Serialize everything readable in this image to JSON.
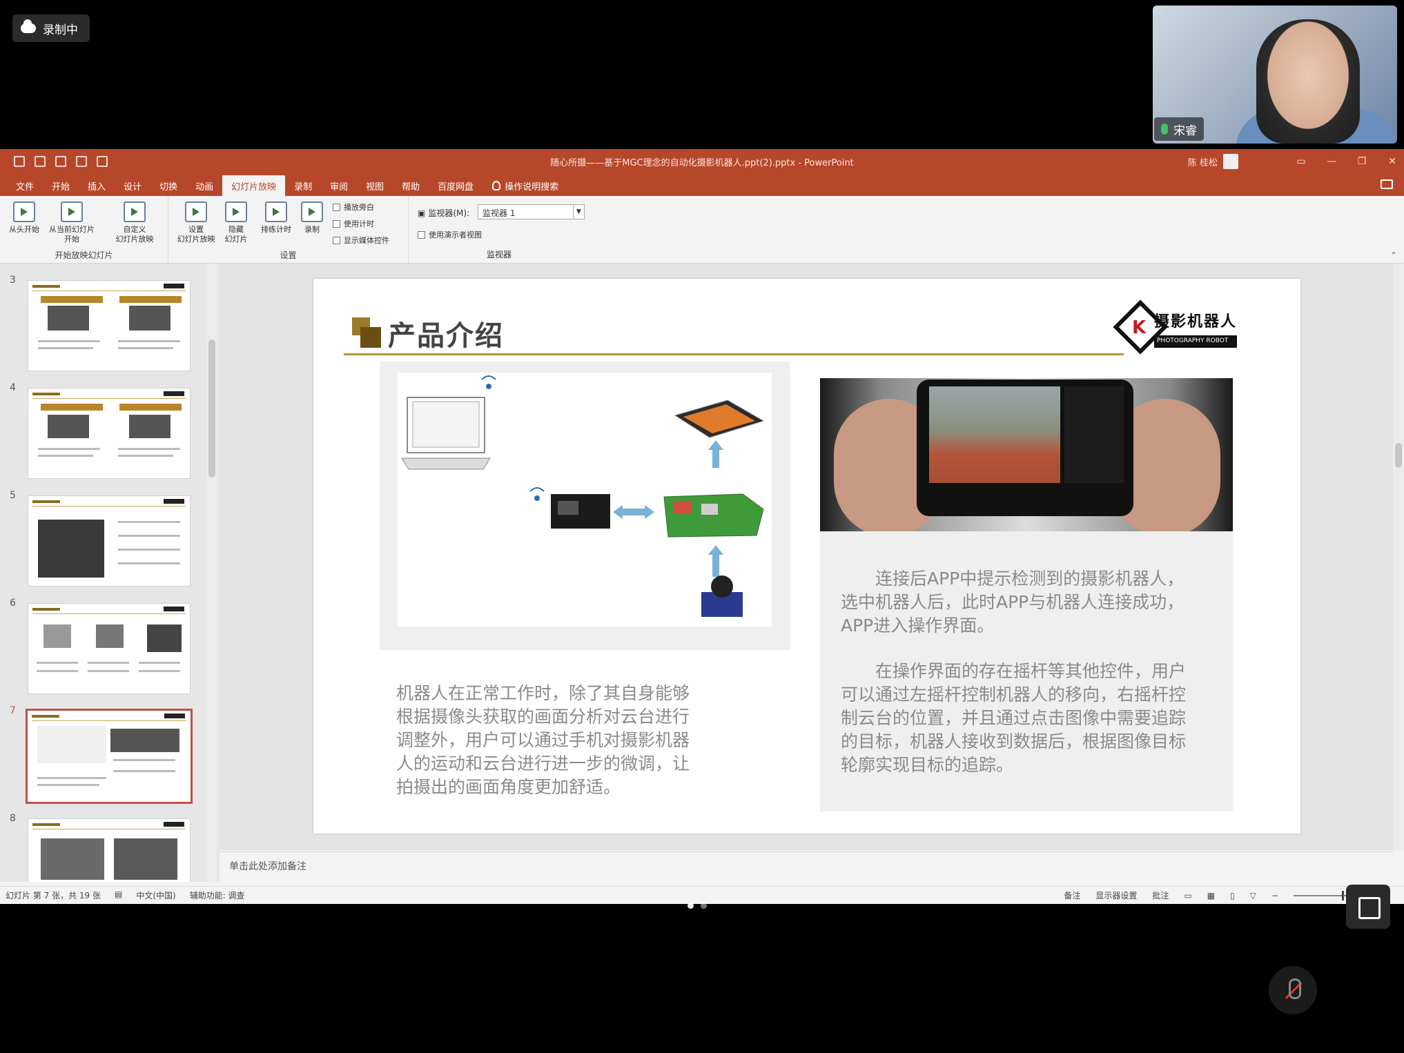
{
  "recording": {
    "label": "录制中"
  },
  "webcam": {
    "name": "宋睿"
  },
  "window": {
    "title": "随心所摄——基于MGC理念的自动化摄影机器人.ppt(2).pptx  -  PowerPoint",
    "user": "陈 桂松"
  },
  "tabs": [
    {
      "label": "文件"
    },
    {
      "label": "开始"
    },
    {
      "label": "插入"
    },
    {
      "label": "设计"
    },
    {
      "label": "切换"
    },
    {
      "label": "动画"
    },
    {
      "label": "幻灯片放映"
    },
    {
      "label": "录制"
    },
    {
      "label": "审阅"
    },
    {
      "label": "视图"
    },
    {
      "label": "帮助"
    },
    {
      "label": "百度网盘"
    }
  ],
  "tell_me": "操作说明搜索",
  "ribbon": {
    "from_start": "从头开始",
    "from_current_1": "从当前幻灯片",
    "from_current_2": "开始",
    "custom_1": "自定义",
    "custom_2": "幻灯片放映",
    "group_start": "开始放映幻灯片",
    "setup_1": "设置",
    "setup_2": "幻灯片放映",
    "hide_1": "隐藏",
    "hide_2": "幻灯片",
    "rehearse": "排练计时",
    "record": "录制",
    "chk_narration": "播放旁白",
    "chk_timing": "使用计时",
    "chk_media": "显示媒体控件",
    "group_setup": "设置",
    "monitor_label": "监视器(M):",
    "monitor_value": "监视器 1",
    "presenter_view": "使用演示者视图",
    "group_monitor": "监视器"
  },
  "thumbnails": [
    {
      "num": "3"
    },
    {
      "num": "4"
    },
    {
      "num": "5"
    },
    {
      "num": "6"
    },
    {
      "num": "7"
    },
    {
      "num": "8"
    }
  ],
  "slide": {
    "title": "产品介绍",
    "logo_name": "摄影机器人",
    "logo_sub": "PHOTOGRAPHY ROBOT",
    "left_text": "机器人在正常工作时，除了其自身能够根据摄像头获取的画面分析对云台进行调整外，用户可以通过手机对摄影机器人的运动和云台进行进一步的微调，让拍摄出的画面角度更加舒适。",
    "right_text_1": "连接后APP中提示检测到的摄影机器人，选中机器人后，此时APP与机器人连接成功，APP进入操作界面。",
    "right_text_2": "在操作界面的存在摇杆等其他控件，用户可以通过左摇杆控制机器人的移向，右摇杆控制云台的位置，并且通过点击图像中需要追踪的目标，机器人接收到数据后，根据图像目标轮廓实现目标的追踪。"
  },
  "notes_placeholder": "单击此处添加备注",
  "status": {
    "slide_info": "幻灯片 第 7 张，共 19 张",
    "language": "中文(中国)",
    "accessibility": "辅助功能: 调查",
    "notes": "备注",
    "display": "显示器设置",
    "comments": "批注"
  }
}
